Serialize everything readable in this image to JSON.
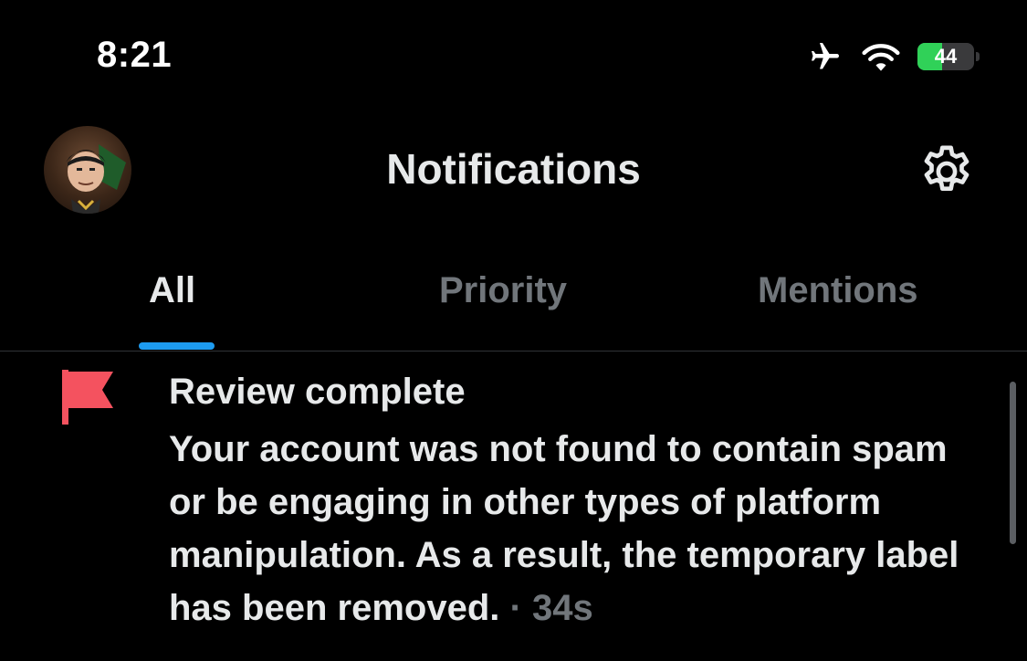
{
  "status_bar": {
    "time": "8:21",
    "battery_level": "44",
    "battery_percent": 44,
    "icons": [
      "airplane-icon",
      "wifi-icon",
      "battery-icon"
    ]
  },
  "header": {
    "title": "Notifications",
    "settings_icon": "gear-icon"
  },
  "tabs": [
    {
      "label": "All",
      "active": true
    },
    {
      "label": "Priority",
      "active": false
    },
    {
      "label": "Mentions",
      "active": false
    }
  ],
  "notifications": [
    {
      "icon": "flag-icon",
      "title": "Review complete",
      "body": "Your account was not found to contain spam or be engaging in other types of platform manipulation. As a result, the temporary label has been removed.",
      "separator": "·",
      "time_ago": "34s"
    }
  ],
  "colors": {
    "background": "#000000",
    "text": "#e7e9ea",
    "muted": "#71767b",
    "accent": "#1d9bf0",
    "flag": "#f4525f",
    "battery": "#30d158"
  }
}
